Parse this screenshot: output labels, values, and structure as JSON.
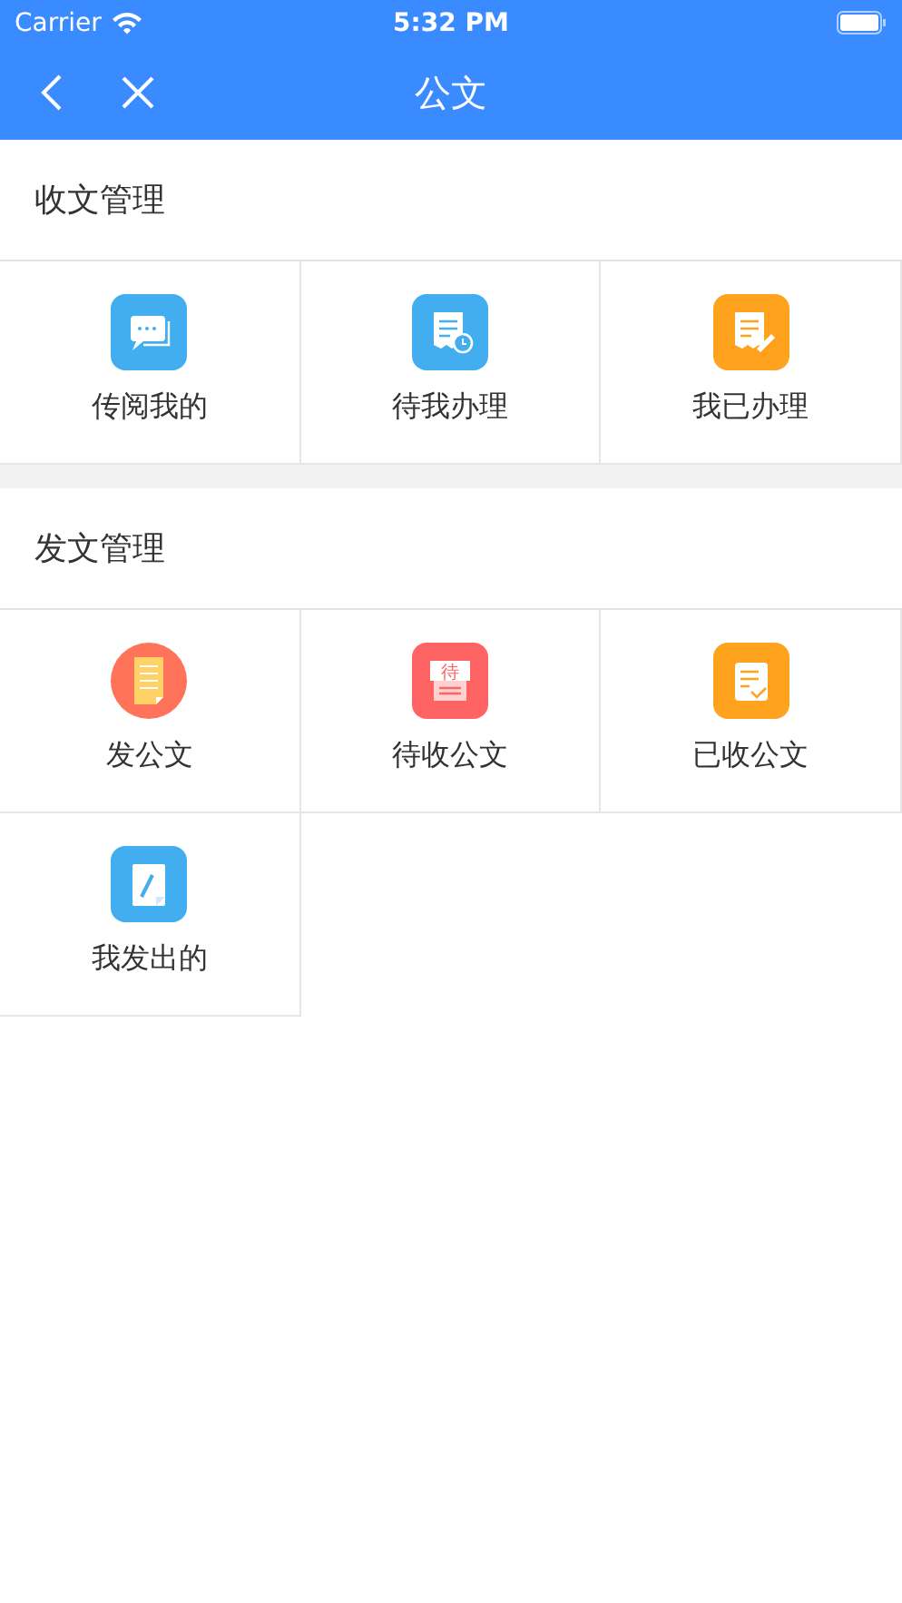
{
  "status_bar": {
    "carrier": "Carrier",
    "time": "5:32 PM"
  },
  "nav": {
    "title": "公文"
  },
  "sections": [
    {
      "title": "收文管理",
      "items": [
        {
          "label": "传阅我的",
          "kind": "chat",
          "color": "#42aef0"
        },
        {
          "label": "待我办理",
          "kind": "clock-doc",
          "color": "#42aef0"
        },
        {
          "label": "我已办理",
          "kind": "edit-doc",
          "color": "#ffa31f"
        }
      ]
    },
    {
      "title": "发文管理",
      "items": [
        {
          "label": "发公文",
          "kind": "paper",
          "color": "#ff735a"
        },
        {
          "label": "待收公文",
          "kind": "tray",
          "color": "#ff6464",
          "icon_text": "待"
        },
        {
          "label": "已收公文",
          "kind": "check-doc",
          "color": "#ffa31f"
        },
        {
          "label": "我发出的",
          "kind": "pen-doc",
          "color": "#42aef0"
        }
      ]
    }
  ]
}
